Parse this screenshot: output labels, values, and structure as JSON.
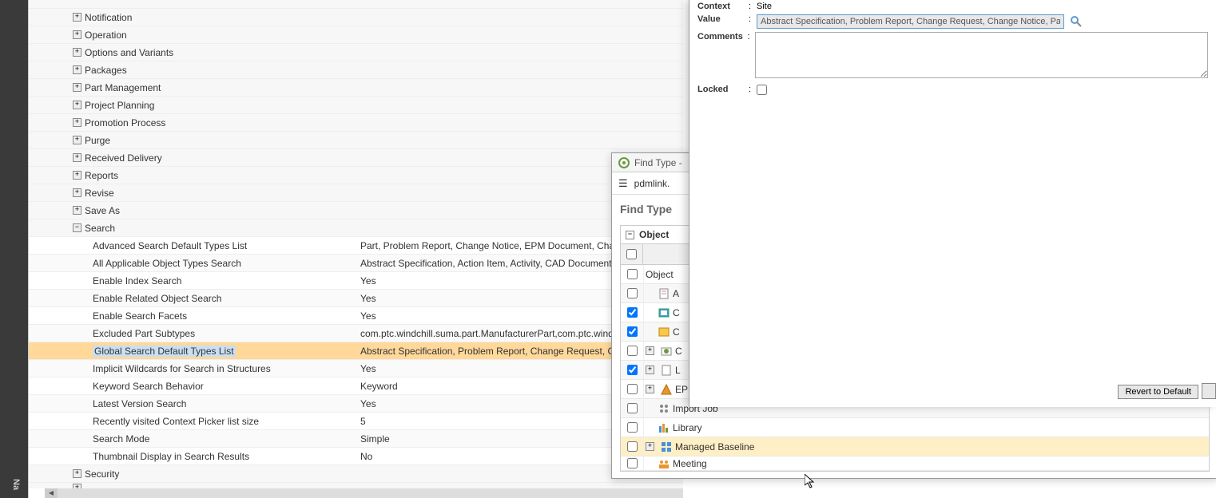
{
  "leftNav": {
    "label": "Na"
  },
  "tree": {
    "categories": [
      {
        "label": "Notification"
      },
      {
        "label": "Operation"
      },
      {
        "label": "Options and Variants"
      },
      {
        "label": "Packages"
      },
      {
        "label": "Part Management"
      },
      {
        "label": "Project Planning"
      },
      {
        "label": "Promotion Process"
      },
      {
        "label": "Purge"
      },
      {
        "label": "Received Delivery"
      },
      {
        "label": "Reports"
      },
      {
        "label": "Revise"
      },
      {
        "label": "Save As"
      }
    ],
    "search": {
      "label": "Search",
      "items": [
        {
          "label": "Advanced Search Default Types List",
          "value": "Part, Problem Report, Change Notice, EPM Document, Change Reques"
        },
        {
          "label": "All Applicable Object Types Search",
          "value": "Abstract Specification, Action Item, Activity, CAD Document, Change No"
        },
        {
          "label": "Enable Index Search",
          "value": "Yes"
        },
        {
          "label": "Enable Related Object Search",
          "value": "Yes"
        },
        {
          "label": "Enable Search Facets",
          "value": "Yes"
        },
        {
          "label": "Excluded Part Subtypes",
          "value": "com.ptc.windchill.suma.part.ManufacturerPart,com.ptc.windchill.suma.pa"
        },
        {
          "label": "Global Search Default Types List",
          "value": "Abstract Specification, Problem Report, Change Request, Change Notic",
          "highlighted": true
        },
        {
          "label": "Implicit Wildcards for Search in Structures",
          "value": "Yes"
        },
        {
          "label": "Keyword Search Behavior",
          "value": "Keyword"
        },
        {
          "label": "Latest Version Search",
          "value": "Yes"
        },
        {
          "label": "Recently visited Context Picker list size",
          "value": "5"
        },
        {
          "label": "Search Mode",
          "value": "Simple"
        },
        {
          "label": "Thumbnail Display in Search Results",
          "value": "No"
        }
      ]
    },
    "security": {
      "label": "Security"
    }
  },
  "rightForm": {
    "contextLabel": "Context",
    "contextValue": "Site",
    "valueLabel": "Value",
    "valueText": "Abstract Specification, Problem Report, Change Request, Change Notice, Part",
    "commentsLabel": "Comments",
    "lockedLabel": "Locked",
    "revertButton": "Revert to Default"
  },
  "findPanel": {
    "windowTitle": "Find Type - ",
    "addressIconTitle": "pdmlink.",
    "heading": "Find Type",
    "sectionTitle": "Object",
    "headerLabel": "Object",
    "rows": [
      {
        "label": "A",
        "checked": false
      },
      {
        "label": "C",
        "checked": true
      },
      {
        "label": "C",
        "checked": true
      },
      {
        "label": "C",
        "checked": false
      },
      {
        "label": "L",
        "checked": true
      },
      {
        "label": "EPM Document",
        "checked": false
      },
      {
        "label": "Import Job",
        "checked": false
      },
      {
        "label": "Library",
        "checked": false
      },
      {
        "label": "Managed Baseline",
        "checked": false,
        "highlighted": true
      },
      {
        "label": "Meeting",
        "checked": false
      }
    ]
  }
}
